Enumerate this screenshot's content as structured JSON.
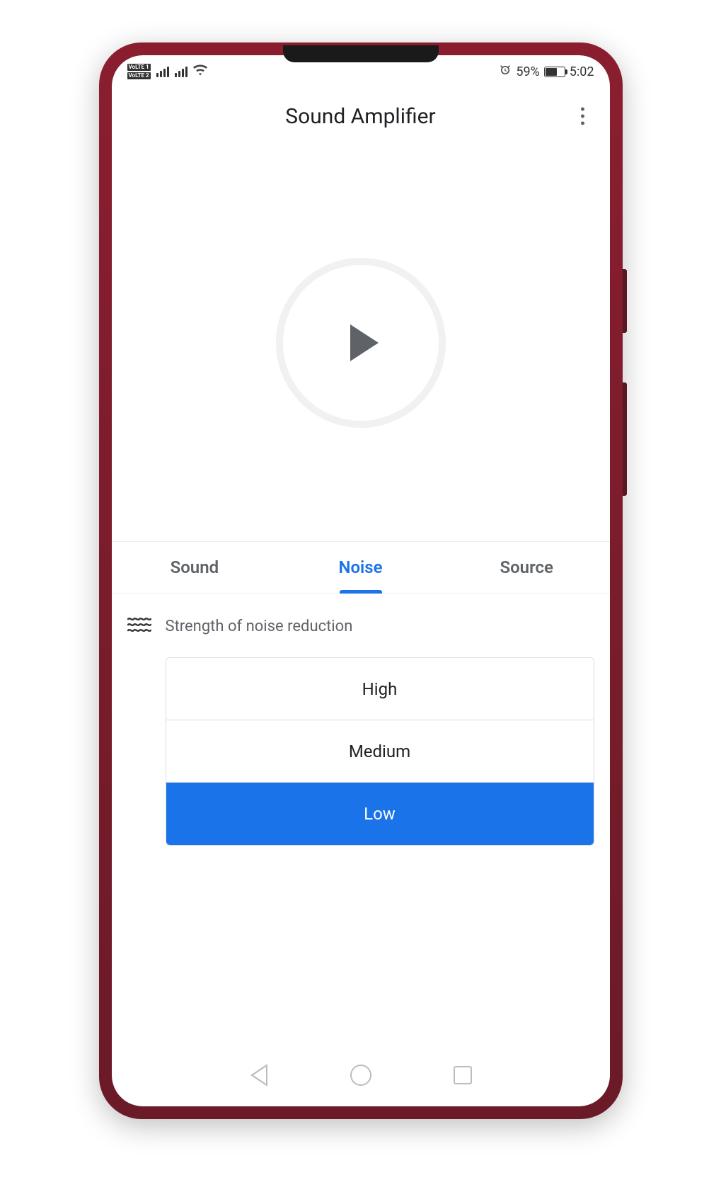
{
  "status_bar": {
    "volte1": "VoLTE 1",
    "volte2": "VoLTE 2",
    "battery_pct": "59%",
    "time": "5:02"
  },
  "header": {
    "title": "Sound Amplifier"
  },
  "tabs": [
    {
      "id": "sound",
      "label": "Sound",
      "active": false
    },
    {
      "id": "noise",
      "label": "Noise",
      "active": true
    },
    {
      "id": "source",
      "label": "Source",
      "active": false
    }
  ],
  "noise_section": {
    "title": "Strength of noise reduction",
    "options": [
      {
        "id": "high",
        "label": "High",
        "selected": false
      },
      {
        "id": "medium",
        "label": "Medium",
        "selected": false
      },
      {
        "id": "low",
        "label": "Low",
        "selected": true
      }
    ]
  }
}
